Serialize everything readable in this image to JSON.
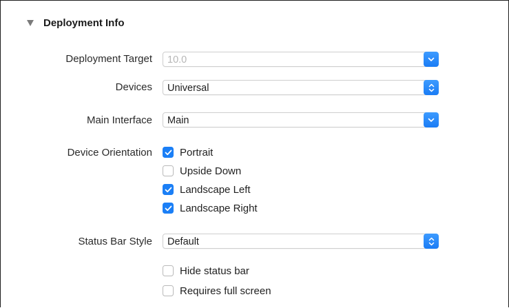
{
  "section": {
    "title": "Deployment Info"
  },
  "fields": {
    "deployment_target": {
      "label": "Deployment Target",
      "value": "10.0",
      "disabled": true
    },
    "devices": {
      "label": "Devices",
      "value": "Universal"
    },
    "main_interface": {
      "label": "Main Interface",
      "value": "Main"
    },
    "device_orientation": {
      "label": "Device Orientation",
      "options": [
        {
          "label": "Portrait",
          "checked": true
        },
        {
          "label": "Upside Down",
          "checked": false
        },
        {
          "label": "Landscape Left",
          "checked": true
        },
        {
          "label": "Landscape Right",
          "checked": true
        }
      ]
    },
    "status_bar_style": {
      "label": "Status Bar Style",
      "value": "Default"
    },
    "status_options": [
      {
        "label": "Hide status bar",
        "checked": false
      },
      {
        "label": "Requires full screen",
        "checked": false
      }
    ]
  },
  "colors": {
    "accent": "#1b7ff6",
    "border": "#1c1c1c"
  },
  "icons": {
    "disclosure": "disclosure-triangle-down-icon",
    "combo": "chevron-down-icon",
    "stepper": "up-down-chevron-icon",
    "check": "checkmark-icon"
  }
}
